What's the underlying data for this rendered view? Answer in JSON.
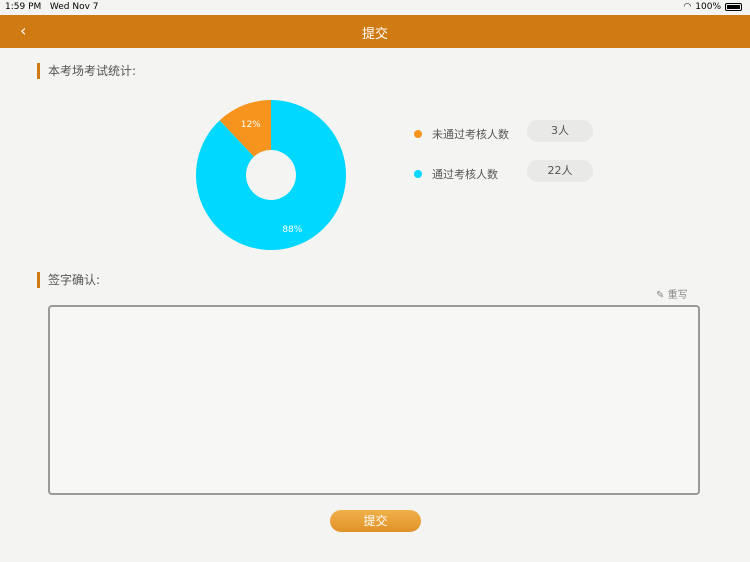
{
  "status_bar": {
    "time": "1:59 PM",
    "date": "Wed Nov 7",
    "battery": "100%"
  },
  "nav": {
    "title": "提交",
    "back_icon": "chevron-left-icon"
  },
  "stats_section": {
    "title": "本考场考试统计:"
  },
  "chart_data": {
    "type": "pie",
    "donut": true,
    "slices": [
      {
        "name": "未通过考核人数",
        "value": 3,
        "percent_label": "12%",
        "color": "#f7941d"
      },
      {
        "name": "通过考核人数",
        "value": 22,
        "percent_label": "88%",
        "color": "#00d8ff"
      }
    ],
    "legend_placement": "right"
  },
  "legend": [
    {
      "label": "未通过考核人数",
      "count": "3人",
      "color": "#f7941d"
    },
    {
      "label": "通过考核人数",
      "count": "22人",
      "color": "#00d8ff"
    }
  ],
  "sign_section": {
    "title": "签字确认:",
    "rewrite_label": "重写"
  },
  "submit_label": "提交"
}
